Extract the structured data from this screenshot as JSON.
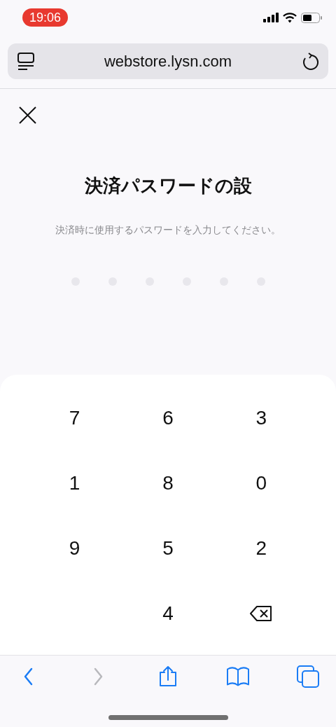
{
  "status_bar": {
    "time": "19:06"
  },
  "address_bar": {
    "url": "webstore.lysn.com"
  },
  "title": "決済パスワードの設",
  "subtitle": "決済時に使用するパスワードを入力してください。",
  "pin_dots": [
    {
      "filled": false
    },
    {
      "filled": false
    },
    {
      "filled": false
    },
    {
      "filled": false
    },
    {
      "filled": false
    },
    {
      "filled": false
    }
  ],
  "keypad": [
    {
      "kind": "digit",
      "label": "7"
    },
    {
      "kind": "digit",
      "label": "6"
    },
    {
      "kind": "digit",
      "label": "3"
    },
    {
      "kind": "digit",
      "label": "1"
    },
    {
      "kind": "digit",
      "label": "8"
    },
    {
      "kind": "digit",
      "label": "0"
    },
    {
      "kind": "digit",
      "label": "9"
    },
    {
      "kind": "digit",
      "label": "5"
    },
    {
      "kind": "digit",
      "label": "2"
    },
    {
      "kind": "empty"
    },
    {
      "kind": "digit",
      "label": "4"
    },
    {
      "kind": "backspace"
    }
  ],
  "toolbar": [
    {
      "kind": "back",
      "disabled": false
    },
    {
      "kind": "forward",
      "disabled": true
    },
    {
      "kind": "share",
      "disabled": false
    },
    {
      "kind": "bookmarks",
      "disabled": false
    },
    {
      "kind": "tabs",
      "disabled": false
    }
  ]
}
